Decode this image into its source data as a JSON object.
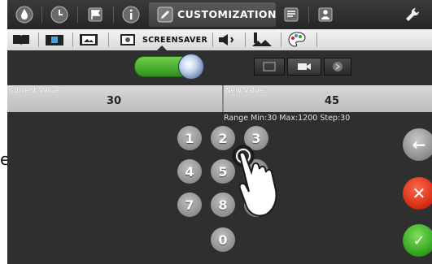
{
  "topnav": {
    "active_label": "CUSTOMIZATION",
    "icons": [
      "water-drop-icon",
      "clock-icon",
      "flag-icon",
      "info-icon",
      "pencil-icon",
      "document-icon",
      "person-icon",
      "wrench-icon"
    ]
  },
  "subnav": {
    "active_label": "SCREENSAVER",
    "icons": [
      "book-icon",
      "photo-book-icon",
      "picture-frame-icon",
      "screensaver-icon",
      "speaker-icon",
      "language-icon",
      "palette-icon"
    ]
  },
  "values": {
    "current_caption": "Current Value",
    "current_value": "30",
    "new_caption": "New Value",
    "new_value": "45",
    "range_text": "Range Min:30 Max:1200 Step:30"
  },
  "keypad": {
    "keys": [
      "1",
      "2",
      "3",
      "4",
      "5",
      "6",
      "7",
      "8",
      "9",
      "0"
    ]
  },
  "actions": {
    "back_glyph": "←",
    "cancel_glyph": "✕",
    "ok_glyph": "✓"
  },
  "side_mark": "e",
  "colors": {
    "accent_green": "#3fb02a",
    "cancel_red": "#d22a12",
    "background": "#2f2f2f"
  }
}
